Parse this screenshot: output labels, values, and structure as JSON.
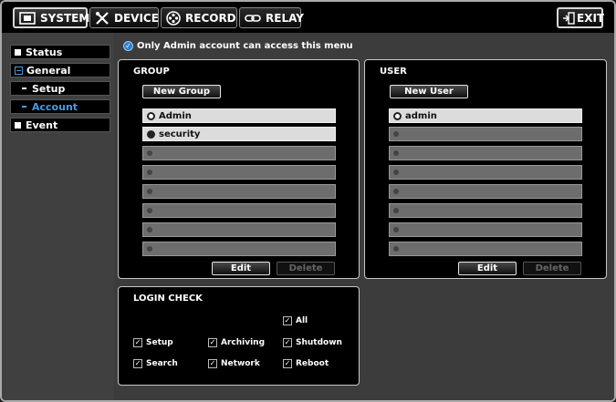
{
  "top_tabs": {
    "system": "SYSTEM",
    "device": "DEVICE",
    "record": "RECORD",
    "relay": "RELAY",
    "exit": "EXIT"
  },
  "sidebar": {
    "status": "Status",
    "general": "General",
    "setup": "Setup",
    "account": "Account",
    "event": "Event"
  },
  "notice": "Only Admin account can access this menu",
  "group": {
    "title": "GROUP",
    "new_label": "New Group",
    "items": [
      "Admin",
      "security",
      "",
      "",
      "",
      "",
      "",
      ""
    ],
    "edit_label": "Edit",
    "delete_label": "Delete"
  },
  "user": {
    "title": "USER",
    "new_label": "New User",
    "items": [
      "admin",
      "",
      "",
      "",
      "",
      "",
      "",
      ""
    ],
    "edit_label": "Edit",
    "delete_label": "Delete"
  },
  "login_check": {
    "title": "LOGIN CHECK",
    "options": {
      "all": "All",
      "setup": "Setup",
      "archiving": "Archiving",
      "shutdown": "Shutdown",
      "search": "Search",
      "network": "Network",
      "reboot": "Reboot"
    }
  },
  "colors": {
    "accent": "#4a9ade",
    "panel_border": "#c8c8c8",
    "sidebar_bg": "#404040",
    "main_bg": "#3c3c3c"
  }
}
